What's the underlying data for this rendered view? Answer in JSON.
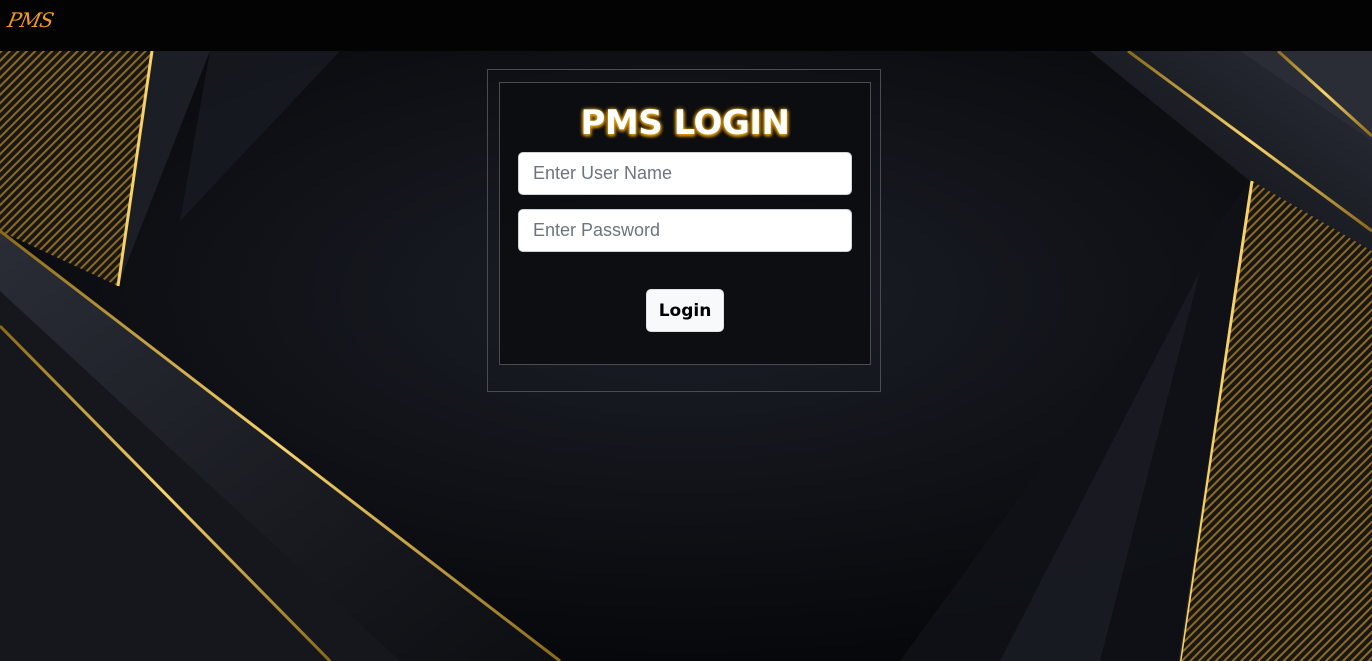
{
  "navbar": {
    "brand": "PMS"
  },
  "login": {
    "title": "PMS LOGIN",
    "username_placeholder": "Enter User Name",
    "password_placeholder": "Enter Password",
    "submit_label": "Login"
  },
  "theme": {
    "accent": "#f39a1c",
    "gold": "#d4a017",
    "background": "#0b0c10"
  }
}
